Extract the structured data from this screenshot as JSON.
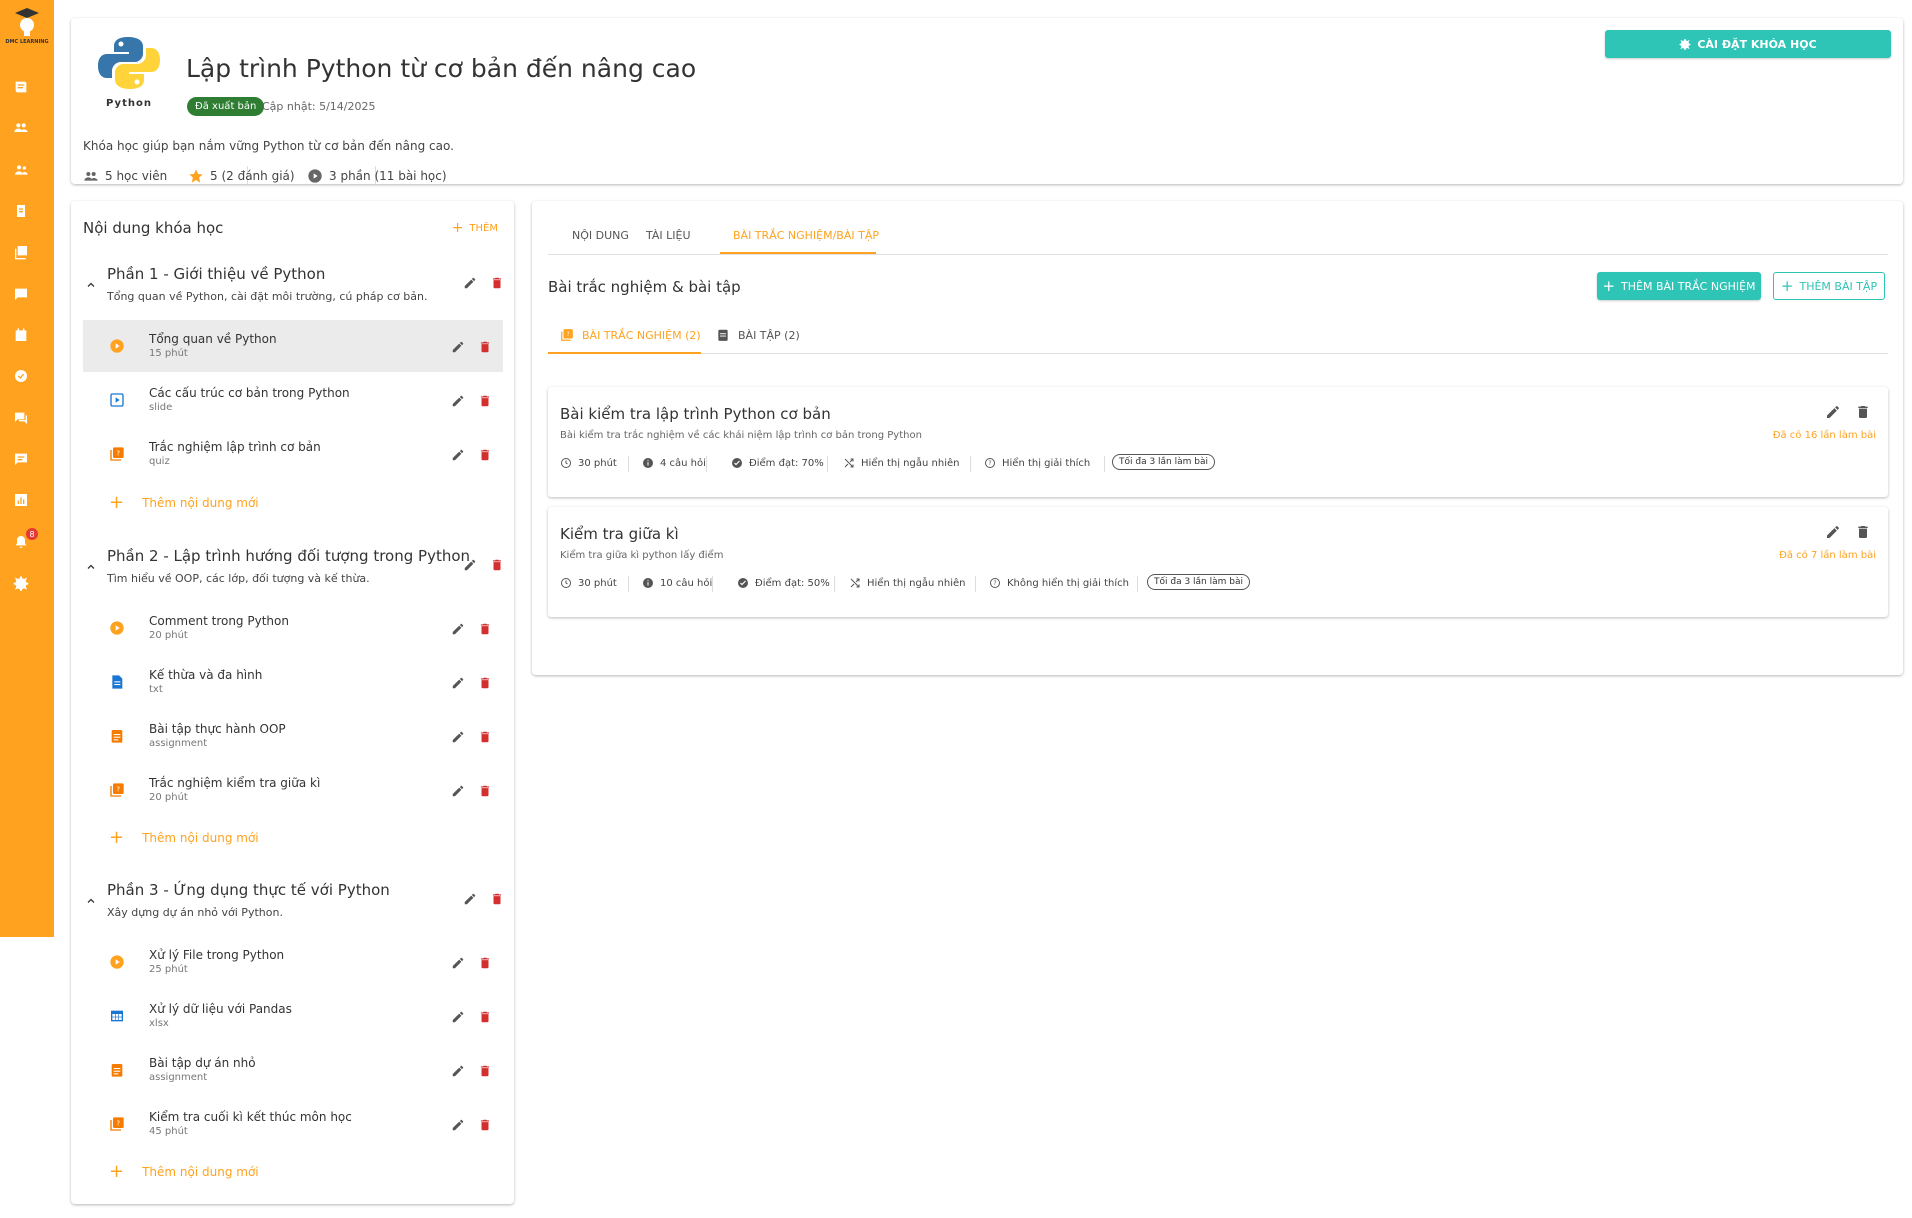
{
  "sidebar": {
    "logo_text": "DMC LEARNING",
    "icons": [
      "book-icon",
      "group-icon",
      "people-icon",
      "assignment-icon",
      "quiz-icon",
      "chat-icon",
      "calendar-icon",
      "check-circle-icon",
      "forum-icon",
      "comment-icon",
      "bar-chart-icon",
      "bell-icon",
      "gear-icon"
    ],
    "notification_count": "8",
    "accent": "#FFA21F"
  },
  "header": {
    "logo_caption": "Python",
    "title": "Lập trình Python từ cơ bản đến nâng cao",
    "status": "Đã xuất bản",
    "updated": "Cập nhật: 5/14/2025",
    "description": "Khóa học giúp bạn nắm vững Python từ cơ bản đến nâng cao.",
    "students": "5 học viên",
    "rating": "5 (2 đánh giá)",
    "sections": "3 phần (11 bài học)",
    "settings_label": "CÀI ĐẶT KHÓA HỌC"
  },
  "content": {
    "title": "Nội dung khóa học",
    "add_label": "THÊM",
    "add_item_label": "Thêm nội dung mới",
    "sections": [
      {
        "title": "Phần 1 - Giới thiệu về Python",
        "subtitle": "Tổng quan về Python, cài đặt môi trường, cú pháp cơ bản.",
        "items": [
          {
            "title": "Tổng quan về Python",
            "sub": "15 phút",
            "icon": "play-circle-icon"
          },
          {
            "title": "Các cấu trúc cơ bản trong Python",
            "sub": "slide",
            "icon": "slideshow-icon"
          },
          {
            "title": "Trắc nghiệm lập trình cơ bản",
            "sub": "quiz",
            "icon": "quiz-icon"
          }
        ]
      },
      {
        "title": "Phần 2 - Lập trình hướng đối tượng trong Python",
        "subtitle": "Tìm hiểu về OOP, các lớp, đối tượng và kế thừa.",
        "items": [
          {
            "title": "Comment trong Python",
            "sub": "20 phút",
            "icon": "play-circle-icon"
          },
          {
            "title": "Kế thừa và đa hình",
            "sub": "txt",
            "icon": "document-icon"
          },
          {
            "title": "Bài tập thực hành OOP",
            "sub": "assignment",
            "icon": "assignment-icon"
          },
          {
            "title": "Trắc nghiệm kiểm tra giữa kì",
            "sub": "20 phút",
            "icon": "quiz-icon"
          }
        ]
      },
      {
        "title": "Phần 3 - Ứng dụng thực tế với Python",
        "subtitle": "Xây dựng dự án nhỏ với Python.",
        "items": [
          {
            "title": "Xử lý File trong Python",
            "sub": "25 phút",
            "icon": "play-circle-icon"
          },
          {
            "title": "Xử lý dữ liệu với Pandas",
            "sub": "xlsx",
            "icon": "table-icon"
          },
          {
            "title": "Bài tập dự án nhỏ",
            "sub": "assignment",
            "icon": "assignment-icon"
          },
          {
            "title": "Kiểm tra cuối kì kết thúc môn học",
            "sub": "45 phút",
            "icon": "quiz-icon"
          }
        ]
      }
    ]
  },
  "tabs": {
    "content": "NỘI DUNG",
    "materials": "TÀI LIỆU",
    "quizzes": "BÀI TRẮC NGHIỆM/BÀI TẬP"
  },
  "quiz_panel": {
    "title": "Bài trắc nghiệm & bài tập",
    "add_quiz": "THÊM BÀI TRẮC NGHIỆM",
    "add_assignment": "THÊM BÀI TẬP",
    "subtab_quiz": "BÀI TRẮC NGHIỆM (2)",
    "subtab_assignment": "BÀI TẬP (2)",
    "quizzes": [
      {
        "title": "Bài kiểm tra lập trình Python cơ bản",
        "desc": "Bài kiểm tra trắc nghiệm về các khái niệm lập trình cơ bản trong Python",
        "attempts": "Đã có 16 lần làm bài",
        "time": "30 phút",
        "questions": "4 câu hỏi",
        "pass": "Điểm đạt: 70%",
        "shuffle": "Hiển thị ngẫu nhiên",
        "explain": "Hiển thị giải thích",
        "max": "Tối đa 3 lần làm bài"
      },
      {
        "title": "Kiểm tra giữa kì",
        "desc": "Kiểm tra giữa kì python lấy điểm",
        "attempts": "Đã có 7 lần làm bài",
        "time": "30 phút",
        "questions": "10 câu hỏi",
        "pass": "Điểm đạt: 50%",
        "shuffle": "Hiển thị ngẫu nhiên",
        "explain": "Không hiển thị giải thích",
        "max": "Tối đa 3 lần làm bài"
      }
    ]
  }
}
